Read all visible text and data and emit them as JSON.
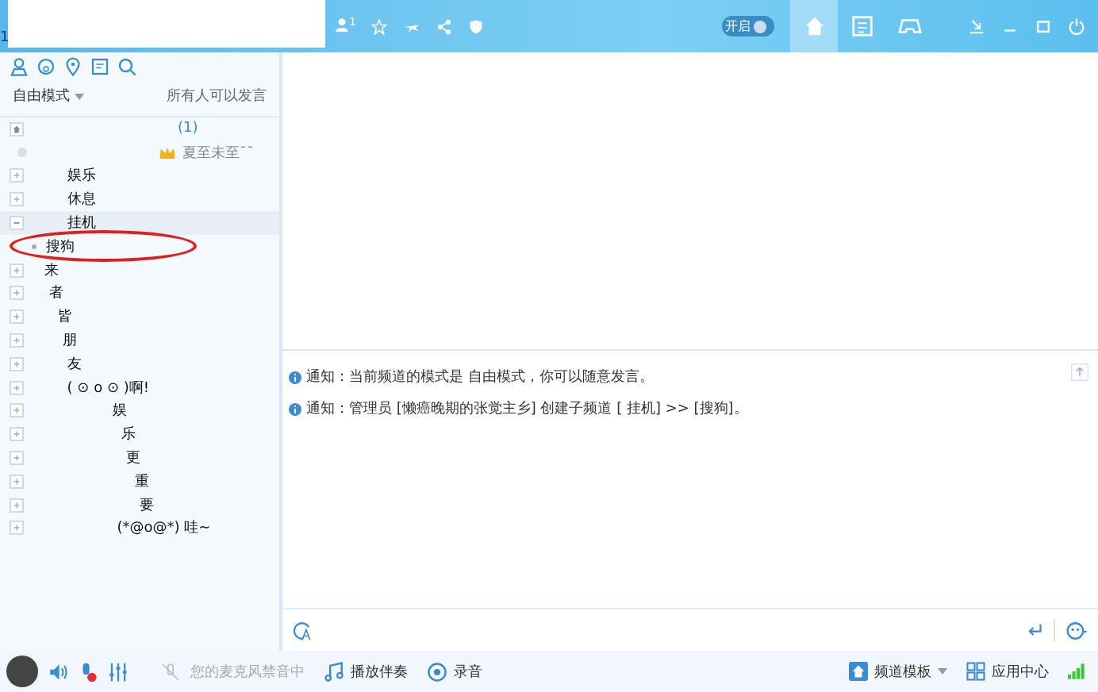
{
  "topbar": {
    "corner_text": "1",
    "online_count": "1",
    "toggle": {
      "label": "开启",
      "on": true
    },
    "tabs": [
      {
        "kind": "home",
        "selected": true
      },
      {
        "kind": "list",
        "selected": false
      },
      {
        "kind": "game",
        "selected": false
      }
    ]
  },
  "sidebar": {
    "mode": "自由模式",
    "permission": "所有人可以发言",
    "root": {
      "count": "(1)"
    },
    "user": {
      "name": "夏至未至¯¯"
    },
    "channels": [
      {
        "name": "     娱乐",
        "expanded": false
      },
      {
        "name": "     休息",
        "expanded": false
      },
      {
        "name": "     挂机",
        "expanded": true,
        "children": [
          {
            "name": "搜狗"
          }
        ]
      },
      {
        "name": "来",
        "expanded": false
      },
      {
        "name": " 者",
        "expanded": false
      },
      {
        "name": "   皆",
        "expanded": false
      },
      {
        "name": "    朋",
        "expanded": false
      },
      {
        "name": "     友",
        "expanded": false
      },
      {
        "name": "     ( ⊙ o ⊙ )啊!",
        "expanded": false
      },
      {
        "name": "               娱",
        "expanded": false
      },
      {
        "name": "                 乐",
        "expanded": false
      },
      {
        "name": "                  更",
        "expanded": false
      },
      {
        "name": "                    重",
        "expanded": false
      },
      {
        "name": "                     要",
        "expanded": false
      },
      {
        "name": "                (*@o@*) 哇~",
        "expanded": false
      }
    ]
  },
  "messages": [
    {
      "label": "通知：",
      "text": "当前频道的模式是 自由模式，你可以随意发言。"
    },
    {
      "label": "通知：",
      "text": "管理员 [懒癌晚期的张觉主乡] 创建子频道 [      挂机] >> [搜狗]。"
    }
  ],
  "statusbar": {
    "mic_muted": true,
    "mic_status": "您的麦克风禁音中",
    "play": "播放伴奏",
    "record": "录音",
    "template": "频道模板",
    "apps": "应用中心"
  }
}
